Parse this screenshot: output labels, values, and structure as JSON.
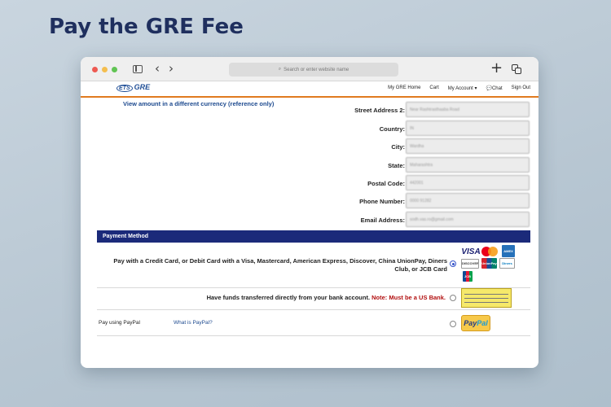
{
  "page_heading": "Pay the GRE Fee",
  "browser": {
    "address_placeholder": "Search or enter website name"
  },
  "site": {
    "logo_ets": "ETS",
    "logo_gre": "GRE",
    "nav": [
      "My GRE Home",
      "Cart",
      "My Account ▾",
      "Chat",
      "Sign Out"
    ]
  },
  "currency_link": "View amount in a different currency (reference only)",
  "form": [
    {
      "label": "Street Address 2:",
      "value": "Near Rashtrasthaaba Road"
    },
    {
      "label": "Country:",
      "value": "IN"
    },
    {
      "label": "City:",
      "value": "Wardha"
    },
    {
      "label": "State:",
      "value": "Maharashtra"
    },
    {
      "label": "Postal Code:",
      "value": "442001"
    },
    {
      "label": "Phone Number:",
      "value": "0000 91282"
    },
    {
      "label": "Email Address:",
      "value": "sodh.vas.ro@gmail.com"
    }
  ],
  "payment": {
    "header": "Payment Method",
    "card_option": "Pay with a Credit Card, or Debit Card with a Visa, Mastercard, American Express, Discover, China UnionPay, Diners Club, or JCB Card",
    "bank_option": "Have funds transferred directly from your bank account.",
    "bank_note": "Note: Must be a US Bank.",
    "paypal_option": "Pay using PayPal",
    "paypal_link": "What is PayPal?",
    "selected": "card"
  },
  "card_logos": {
    "visa": "VISA",
    "amex": "AMEX",
    "discover": "DISCOVER",
    "unionpay": "UnionPay",
    "diners": "Diners",
    "jcb": "JCB"
  },
  "paypal_logo": [
    "Pay",
    "Pal"
  ]
}
